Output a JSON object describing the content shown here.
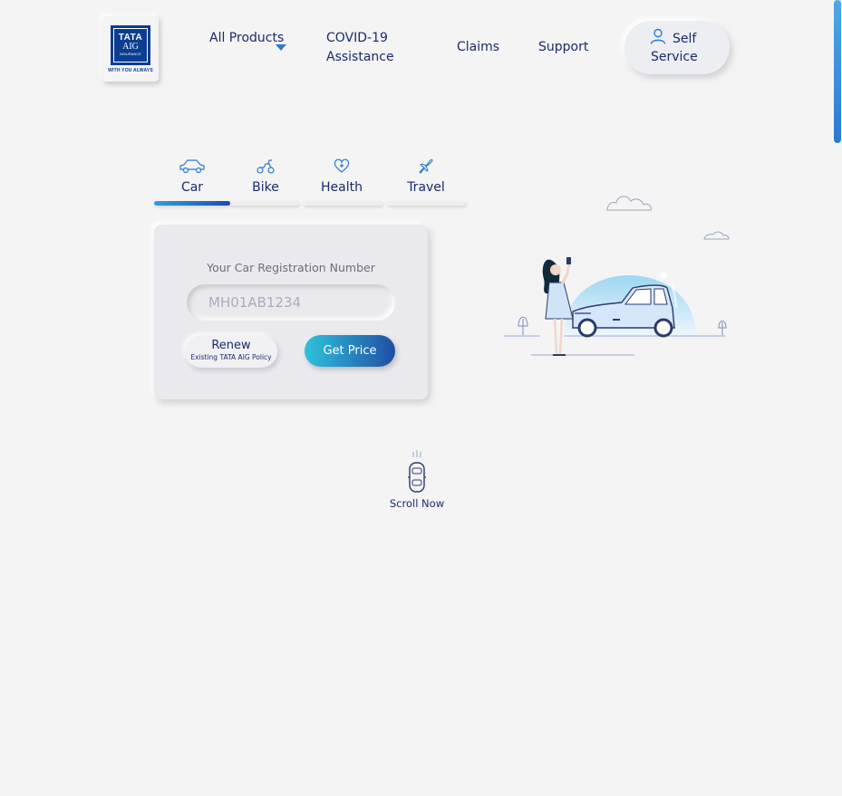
{
  "brand": {
    "logo_line1": "TATA",
    "logo_line2": "AIG",
    "logo_line3": "INSURANCE",
    "tagline": "WITH YOU ALWAYS"
  },
  "nav": {
    "all_products": "All Products",
    "covid": "COVID-19 Assistance",
    "claims": "Claims",
    "support": "Support",
    "self_service_1": "Self",
    "self_service_2": "Service"
  },
  "tabs": [
    {
      "label": "Car",
      "icon": "car-icon",
      "active": true
    },
    {
      "label": "Bike",
      "icon": "scooter-icon",
      "active": false
    },
    {
      "label": "Health",
      "icon": "heart-plus-icon",
      "active": false
    },
    {
      "label": "Travel",
      "icon": "airplane-icon",
      "active": false
    }
  ],
  "form": {
    "label": "Your Car Registration Number",
    "placeholder": "MH01AB1234",
    "value": "",
    "renew_label": "Renew",
    "renew_sub": "Existing TATA AIG Policy",
    "get_price_label": "Get Price"
  },
  "scroll": {
    "label": "Scroll Now"
  },
  "colors": {
    "primary_navy": "#1b2a6b",
    "accent_blue": "#2a7ad0",
    "gradient_start": "#2fc1dc",
    "gradient_end": "#1f4fa3",
    "background": "#f4f4f5"
  }
}
